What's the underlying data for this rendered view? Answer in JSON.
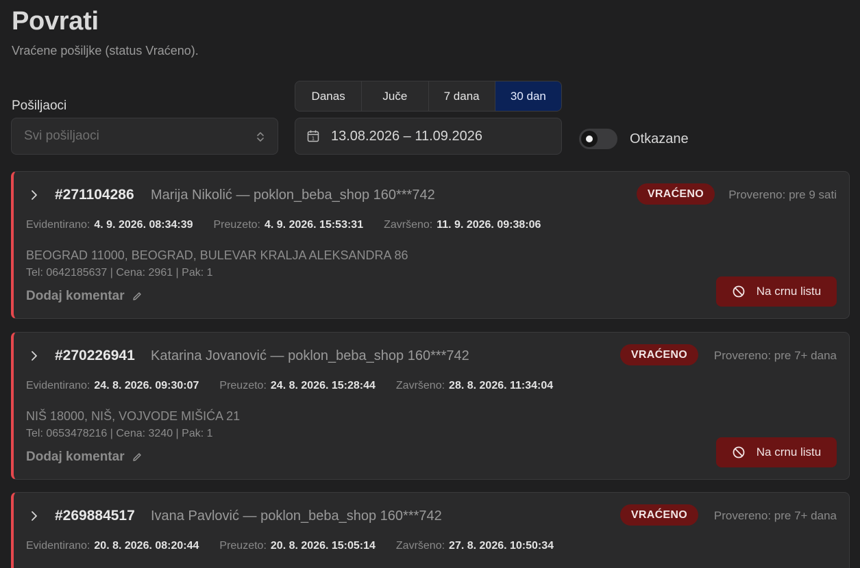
{
  "page": {
    "title": "Povrati",
    "subtitle": "Vraćene pošiljke (status Vraćeno)."
  },
  "filters": {
    "sender_label": "Pošiljaoci",
    "sender_placeholder": "Svi pošiljaoci",
    "ranges": [
      {
        "label": "Danas",
        "active": false
      },
      {
        "label": "Juče",
        "active": false
      },
      {
        "label": "7 dana",
        "active": false
      },
      {
        "label": "30 dan",
        "active": true
      }
    ],
    "date_range": "13.08.2026 – 11.09.2026",
    "toggle_label": "Otkazane",
    "toggle_on": false
  },
  "labels": {
    "registered": "Evidentirano:",
    "picked_up": "Preuzeto:",
    "completed": "Završeno:",
    "add_comment": "Dodaj komentar",
    "blacklist": "Na crnu listu"
  },
  "shipments": [
    {
      "id": "#271104286",
      "customer": "Marija Nikolić — poklon_beba_shop 160***742",
      "status": "VRAĆENO",
      "checked": "Provereno: pre 9 sati",
      "registered": "4. 9. 2026. 08:34:39",
      "picked_up": "4. 9. 2026. 15:53:31",
      "completed": "11. 9. 2026. 09:38:06",
      "address": "BEOGRAD 11000, BEOGRAD, BULEVAR KRALJA ALEKSANDRA 86",
      "meta": "Tel: 0642185637 | Cena: 2961 | Pak: 1"
    },
    {
      "id": "#270226941",
      "customer": "Katarina Jovanović — poklon_beba_shop 160***742",
      "status": "VRAĆENO",
      "checked": "Provereno: pre 7+ dana",
      "registered": "24. 8. 2026. 09:30:07",
      "picked_up": "24. 8. 2026. 15:28:44",
      "completed": "28. 8. 2026. 11:34:04",
      "address": "NIŠ 18000, NIŠ, VOJVODE MIŠIĆA 21",
      "meta": "Tel: 0653478216 | Cena: 3240 | Pak: 1"
    },
    {
      "id": "#269884517",
      "customer": "Ivana Pavlović — poklon_beba_shop 160***742",
      "status": "VRAĆENO",
      "checked": "Provereno: pre 7+ dana",
      "registered": "20. 8. 2026. 08:20:44",
      "picked_up": "20. 8. 2026. 15:05:14",
      "completed": "27. 8. 2026. 10:50:34",
      "address": "",
      "meta": ""
    }
  ]
}
